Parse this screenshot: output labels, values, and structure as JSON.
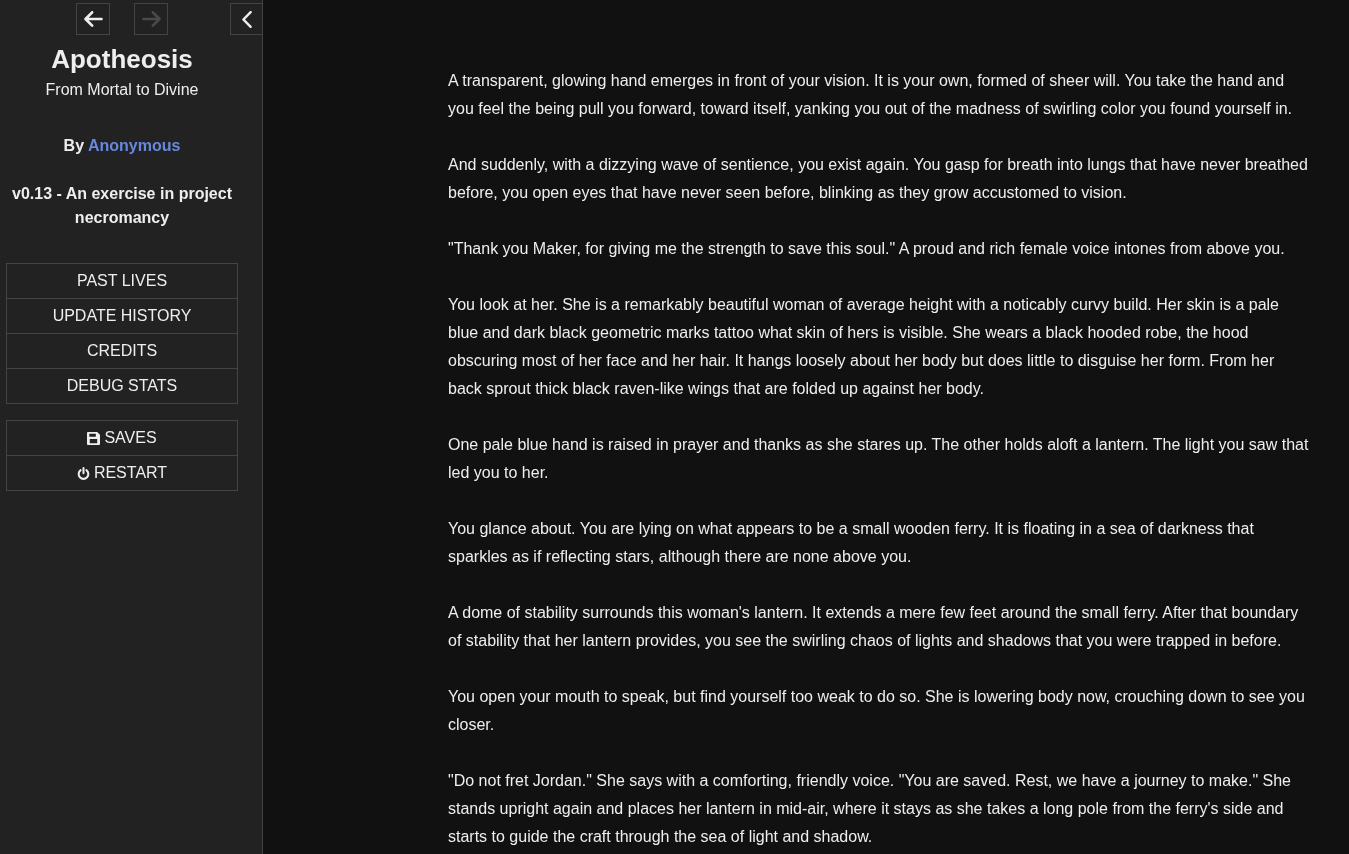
{
  "history_controls": [
    {
      "kind": "back",
      "disabled": false
    },
    {
      "kind": "forward",
      "disabled": true
    }
  ],
  "story": {
    "title": "Apotheosis",
    "subtitle": "From Mortal to Divine",
    "byline": {
      "prefix": "By",
      "author": "Anonymous"
    },
    "version": "v0.13 - An exercise in project necromancy"
  },
  "menu": [
    "PAST LIVES",
    "UPDATE HISTORY",
    "CREDITS",
    "DEBUG STATS"
  ],
  "core_menu": [
    {
      "kind": "saves",
      "label": "SAVES"
    },
    {
      "kind": "restart",
      "label": "RESTART"
    }
  ],
  "passage": [
    "A transparent, glowing hand emerges in front of your vision. It is your own, formed of sheer will. You take the hand and you feel the being pull you forward, toward itself, yanking you out of the madness of swirling color you found yourself in.",
    "And suddenly, with a dizzying wave of sentience, you exist again. You gasp for breath into lungs that have never breathed before, you open eyes that have never seen before, blinking as they grow accustomed to vision.",
    "\"Thank you Maker, for giving me the strength to save this soul.\" A proud and rich female voice intones from above you.",
    "You look at her. She is a remarkably beautiful woman of average height with a noticably curvy build. Her skin is a pale blue and dark black geometric marks tattoo what skin of hers is visible. She wears a black hooded robe, the hood obscuring most of her face and her hair. It hangs loosely about her body but does little to disguise her form. From her back sprout thick black raven-like wings that are folded up against her body.",
    "One pale blue hand is raised in prayer and thanks as she stares up. The other holds aloft a lantern. The light you saw that led you to her.",
    "You glance about. You are lying on what appears to be a small wooden ferry. It is floating in a sea of darkness that sparkles as if reflecting stars, although there are none above you.",
    "A dome of stability surrounds this woman's lantern. It extends a mere few feet around the small ferry. After that boundary of stability that her lantern provides, you see the swirling chaos of lights and shadows that you were trapped in before.",
    "You open your mouth to speak, but find yourself too weak to do so. She is lowering body now, crouching down to see you closer.",
    "\"Do not fret Jordan.\" She says with a comforting, friendly voice. \"You are saved. Rest, we have a journey to make.\" She stands upright again and places her lantern in mid-air, where it stays as she takes a long pole from the ferry's side and starts to guide the craft through the sea of light and shadow."
  ]
}
